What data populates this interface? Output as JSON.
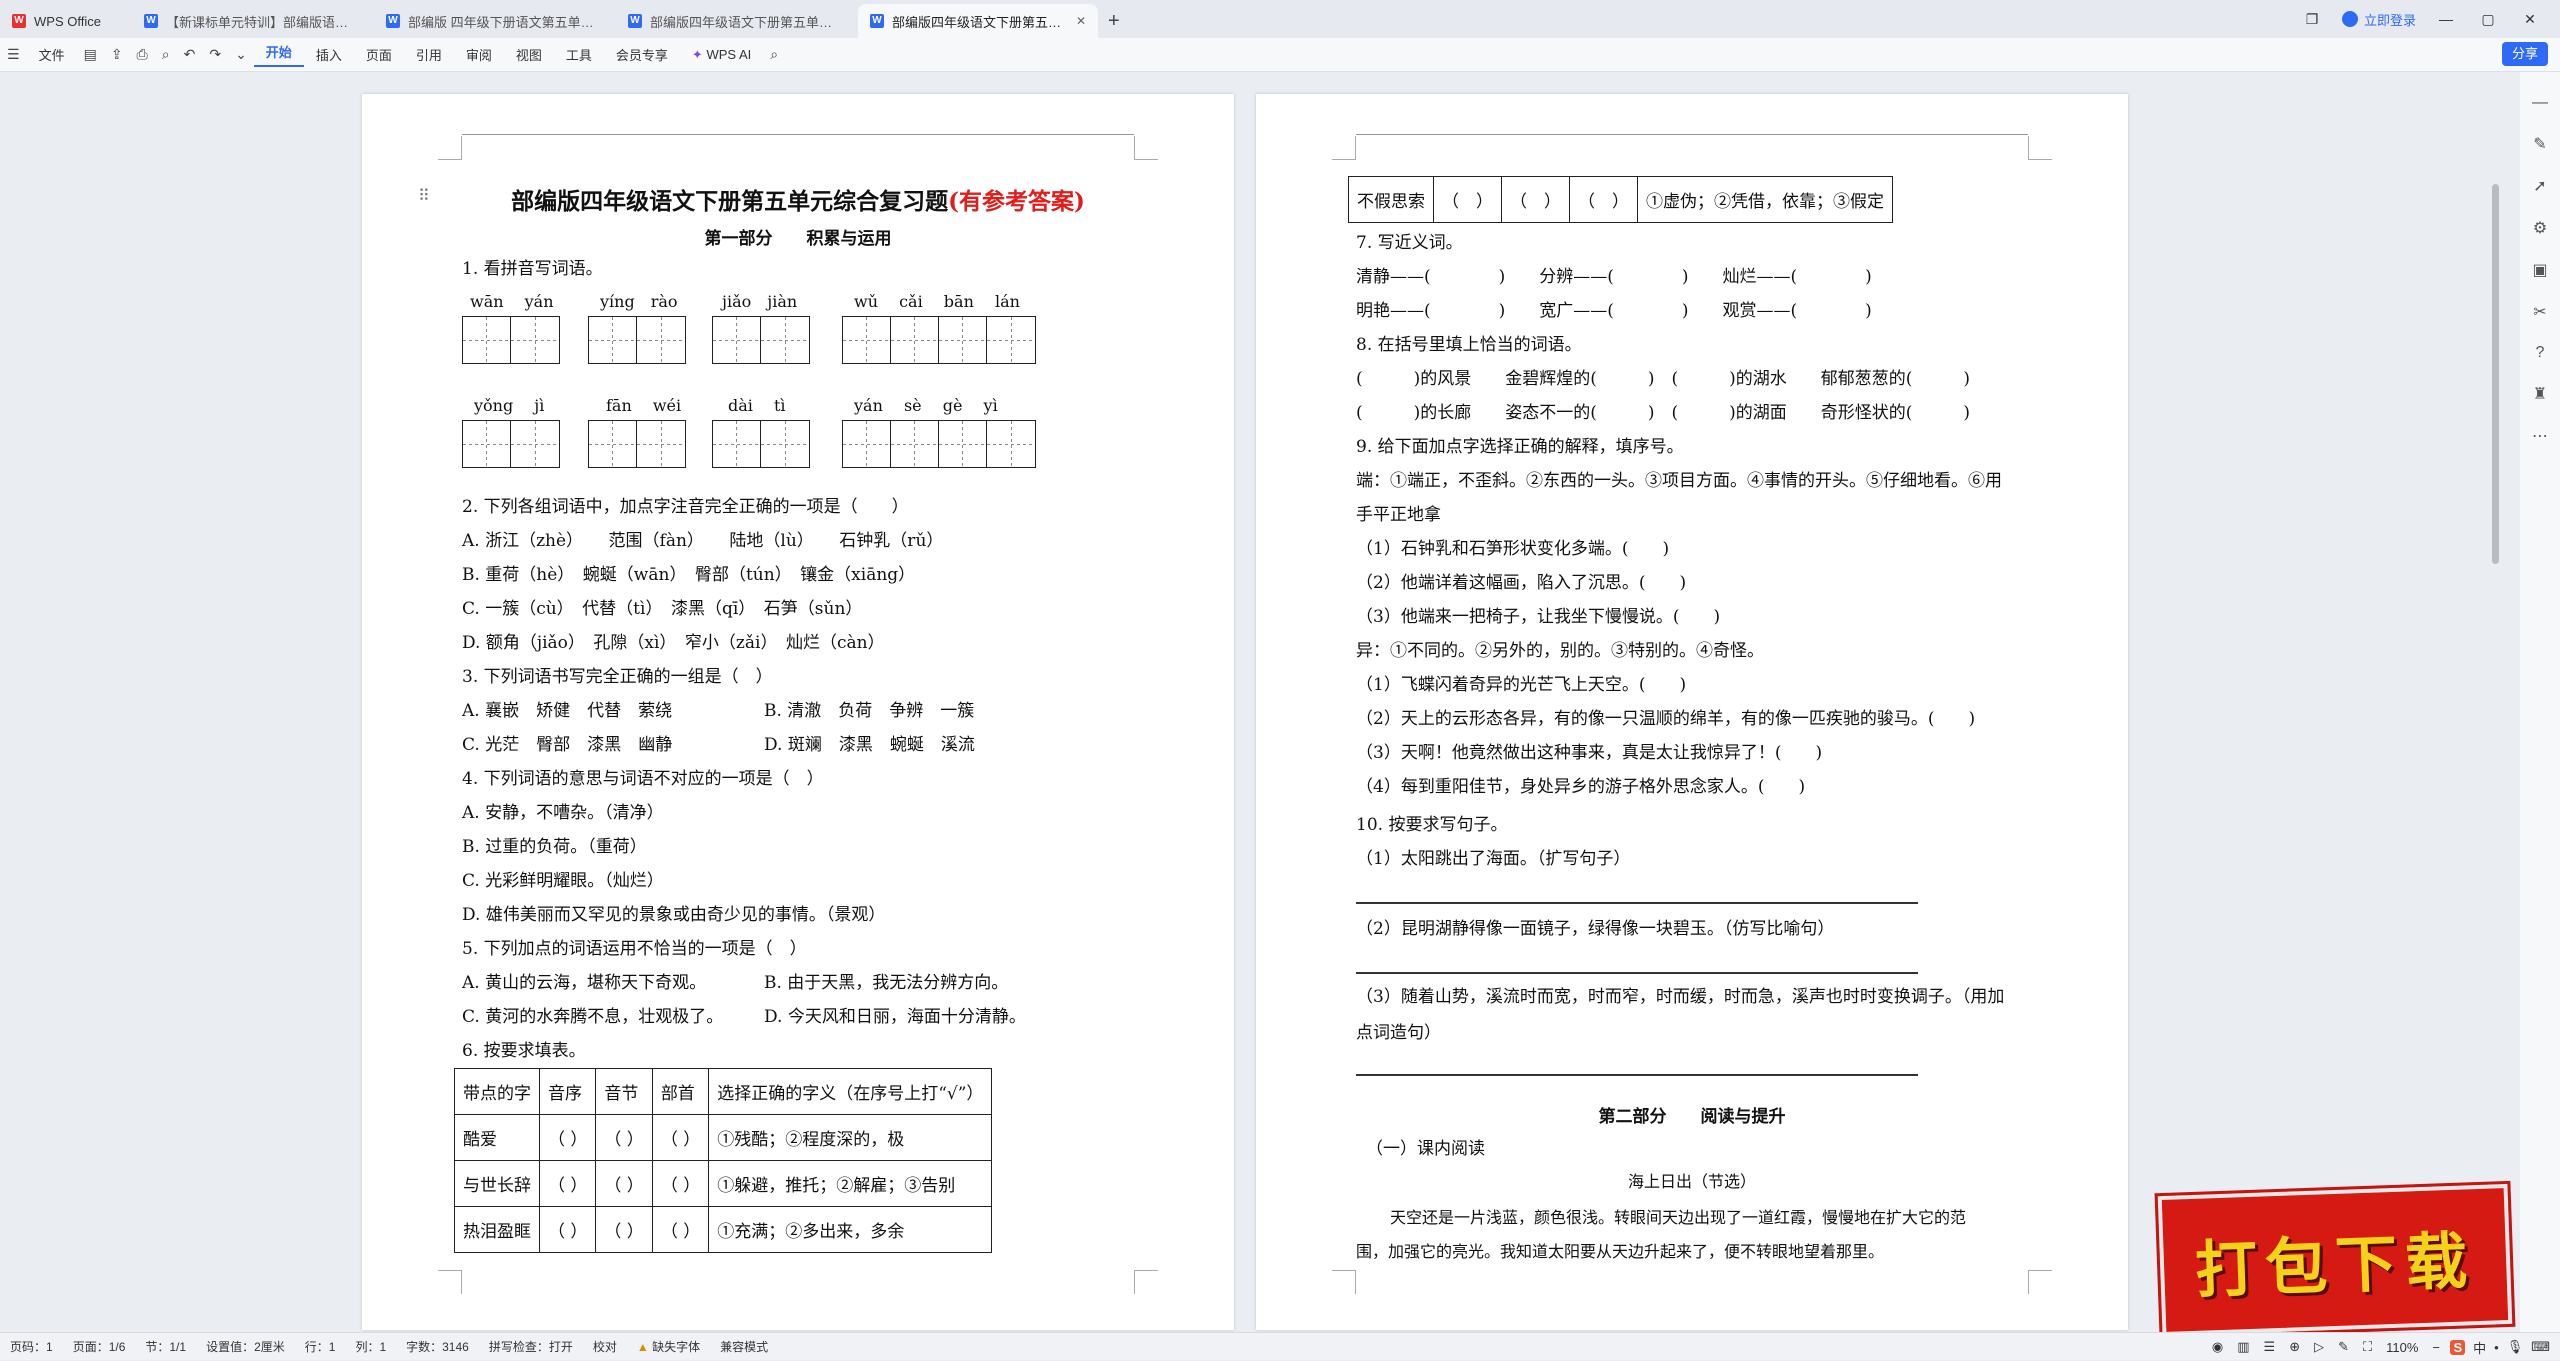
{
  "titlebar": {
    "tabs": [
      {
        "label": "WPS Office"
      },
      {
        "label": "【新课标单元特训】部编版语文四年级下册"
      },
      {
        "label": "部编版 四年级下册语文第五单元测试"
      },
      {
        "label": "部编版四年级语文下册第五单元试卷"
      },
      {
        "label": "部编版四年级语文下册第五单元"
      }
    ],
    "login": "立即登录"
  },
  "toolbar": {
    "file": "文件",
    "menus": [
      "开始",
      "插入",
      "页面",
      "引用",
      "审阅",
      "视图",
      "工具",
      "会员专享"
    ],
    "wps_ai": "WPS AI",
    "share": "分享"
  },
  "page1": {
    "title": "部编版四年级语文下册第五单元综合复习题",
    "title_red": "(有参考答案)",
    "part1": "第一部分　　积累与运用",
    "q1": "1.  看拼音写词语。",
    "pinyin_row1": [
      "wān　 yán",
      "yíng　rào",
      "jiǎo　jiàn",
      "wǔ　 cǎi　 bān　 lán"
    ],
    "pinyin_row2": [
      "yǒng　 jì",
      "fān　 wéi",
      "dài　 tì",
      "yán　 sè　 gè　 yì"
    ],
    "q2": "2.  下列各组词语中，加点字注音完全正确的一项是（　　）",
    "q2a": "A.  浙江（zhè）　　范围（fàn）　　陆地（lù）　　石钟乳（rǔ）",
    "q2b": "B.  重荷（hè）　蜿蜒（wān）　臀部（tún）　镶金（xiāng）",
    "q2c": "C.  一簇（cù）　代替（tì）　漆黑（qī）　石笋（sǔn）",
    "q2d": "D.  额角（jiǎo）　孔隙（xì）　窄小（zǎi）　灿烂（càn）",
    "q3": "3.  下列词语书写完全正确的一组是（　）",
    "q3a": "A.  襄嵌　矫健　代替　萦绕",
    "q3b": "B.  清澈　负荷　争辨　一簇",
    "q3c": "C.  光茫　臀部　漆黑　幽静",
    "q3d": "D.  斑斓　漆黑　蜿蜒　溪流",
    "q4": "4.  下列词语的意思与词语不对应的一项是（　）",
    "q4a": "A.  安静，不嘈杂。（清净）",
    "q4b": "B.  过重的负荷。（重荷）",
    "q4c": "C.  光彩鲜明耀眼。（灿烂）",
    "q4d": "D.  雄伟美丽而又罕见的景象或由奇少见的事情。（景观）",
    "q5": "5.  下列加点的词语运用不恰当的一项是（　）",
    "q5a": "A.  黄山的云海，堪称天下奇观。",
    "q5b": "B.  由于天黑，我无法分辨方向。",
    "q5c": "C.  黄河的水奔腾不息，壮观极了。",
    "q5d": "D.  今天风和日丽，海面十分清静。",
    "q6": "6.  按要求填表。",
    "table_header": [
      "带点的字",
      "音序",
      "音节",
      "部首",
      "选择正确的字义（在序号上打“√”）"
    ],
    "table_rows": [
      [
        "酷爱",
        "（ ）",
        "（ ）",
        "（ ）",
        "①残酷；②程度深的，极"
      ],
      [
        "与世长辞",
        "（ ）",
        "（ ）",
        "（ ）",
        "①躲避，推托；②解雇；③告别"
      ],
      [
        "热泪盈眶",
        "（ ）",
        "（ ）",
        "（ ）",
        "①充满；②多出来，多余"
      ]
    ]
  },
  "page2": {
    "top_row": [
      "不假思索",
      "（　）",
      "（　）",
      "（　）",
      "①虚伪；②凭借，依靠；③假定"
    ],
    "q7": "7.  写近义词。",
    "q7l1": "清静——(　　　　)　　分辨——(　　　　)　　灿烂——(　　　　)",
    "q7l2": "明艳——(　　　　)　　宽广——(　　　　)　　观赏——(　　　　)",
    "q8": "8.  在括号里填上恰当的词语。",
    "q8l1": "(　　　)的风景　　金碧辉煌的(　　　)　(　　　)的湖水　　郁郁葱葱的(　　　)",
    "q8l2": "(　　　)的长廊　　姿态不一的(　　　)　(　　　)的湖面　　奇形怪状的(　　　)",
    "q9": "9.  给下面加点字选择正确的解释，填序号。",
    "q9d1": "端：①端正，不歪斜。②东西的一头。③项目方面。④事情的开头。⑤仔细地看。⑥用",
    "q9d2": "手平正地拿",
    "q9s1": "（1）石钟乳和石笋形状变化多端。(　　)",
    "q9s2": "（2）他端详着这幅画，陷入了沉思。(　　)",
    "q9s3": "（3）他端来一把椅子，让我坐下慢慢说。(　　)",
    "q9d3": "异：①不同的。②另外的，别的。③特别的。④奇怪。",
    "q9s4": "（1）飞蝶闪着奇异的光芒飞上天空。(　　)",
    "q9s5": "（2）天上的云形态各异，有的像一只温顺的绵羊，有的像一匹疾驰的骏马。(　　)",
    "q9s6": "（3）天啊！他竟然做出这种事来，真是太让我惊异了！(　　)",
    "q9s7": "（4）每到重阳佳节，身处异乡的游子格外思念家人。(　　)",
    "q10": "10.  按要求写句子。",
    "q10a": "（1）太阳跳出了海面。（扩写句子）",
    "q10b": "（2）昆明湖静得像一面镜子，绿得像一块碧玉。（仿写比喻句）",
    "q10c1": "（3）随着山势，溪流时而宽，时而窄，时而缓，时而急，溪声也时时变换调子。（用加",
    "q10c2": "点词造句）",
    "part2": "第二部分　　阅读与提升",
    "reading1": "（一）课内阅读",
    "passage_title": "海上日出（节选）",
    "passage1": "天空还是一片浅蓝，颜色很浅。转眼间天边出现了一道红霞，慢慢地在扩大它的范",
    "passage2": "围，加强它的亮光。我知道太阳要从天边升起来了，便不转眼地望着那里。"
  },
  "watermark": "打包下载",
  "status": {
    "items": [
      "页码：1",
      "页面：1/6",
      "节：1/1",
      "设置值：2厘米",
      "行：1",
      "列：1",
      "字数：3146",
      "拼写检查：打开",
      "校对",
      "缺失字体",
      "兼容模式"
    ],
    "zoom": "110%"
  }
}
